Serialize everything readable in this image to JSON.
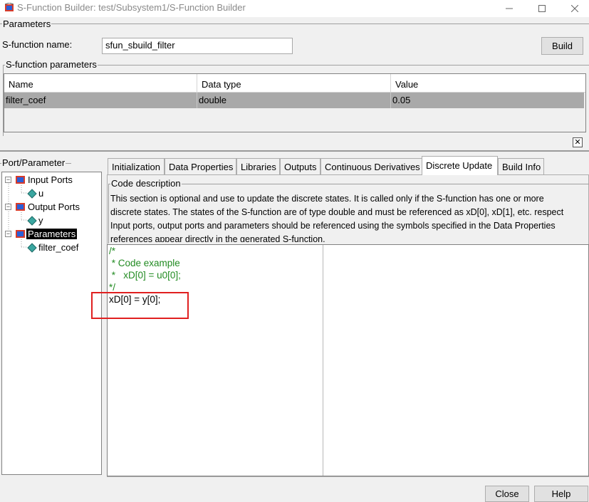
{
  "window": {
    "title": "S-Function Builder: test/Subsystem1/S-Function Builder",
    "icons": [
      "simulink-app-icon",
      "minimize-icon",
      "maximize-icon",
      "close-icon"
    ]
  },
  "parameters_group": {
    "legend": "Parameters",
    "name_label": "S-function name:",
    "name_value": "sfun_sbuild_filter",
    "build_button": "Build"
  },
  "sfun_params": {
    "legend": "S-function parameters",
    "columns": [
      "Name",
      "Data type",
      "Value"
    ],
    "rows": [
      {
        "name": "filter_coef",
        "type": "double",
        "value": "0.05"
      }
    ],
    "collapse_glyph": "✕"
  },
  "port_panel": {
    "legend": "Port/Parameter",
    "tree": [
      {
        "label": "Input Ports",
        "expander": "−"
      },
      {
        "label": "u"
      },
      {
        "label": "Output Ports",
        "expander": "−"
      },
      {
        "label": "y"
      },
      {
        "label": "Parameters",
        "expander": "−"
      },
      {
        "label": "filter_coef"
      }
    ]
  },
  "tabs": [
    "Initialization",
    "Data Properties",
    "Libraries",
    "Outputs",
    "Continuous Derivatives",
    "Discrete Update",
    "Build Info"
  ],
  "active_tab": "Discrete Update",
  "code_description": {
    "legend": "Code description",
    "lines": [
      "This section is optional and use to update the discrete states. It is called only if the S-function has one or more",
      "discrete states. The states of the S-function are of type double and must be referenced as xD[0], xD[1], etc. respect",
      "Input ports, output ports and parameters should be referenced using the symbols specified in the Data Properties",
      "references appear directly in the generated S-function."
    ]
  },
  "editor": {
    "comment_lines": [
      "/*",
      " * Code example",
      " *   xD[0] = u0[0];",
      "*/"
    ],
    "code_line": "xD[0] = y[0];"
  },
  "footer": {
    "close_button": "Close",
    "help_button": "Help"
  },
  "colors": {
    "comment": "#228b22",
    "highlight": "#e02020",
    "selected_row": "#a9a9a9"
  }
}
